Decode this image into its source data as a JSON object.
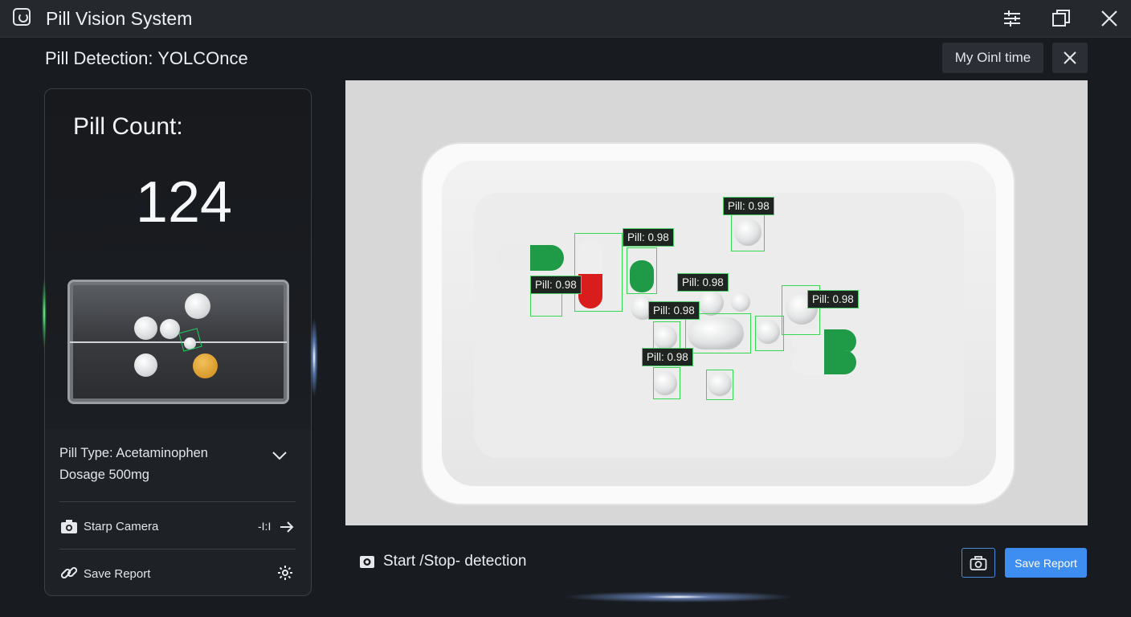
{
  "window": {
    "title": "Pill Vision System"
  },
  "header": {
    "subtitle": "Pill Detection: YOLCOnce",
    "mode_button": "My Oinl time"
  },
  "panel": {
    "count_label": "Pill Count:",
    "count_value": "124",
    "pill_type": "Pill Type: Acetaminophen",
    "dosage": "Dosage 500mg",
    "camera_label": "Starp Camera",
    "camera_value": "-I:I",
    "save_label": "Save Report"
  },
  "detections": [
    {
      "label": "Pill: 0.98"
    },
    {
      "label": "Pill: 0.98"
    },
    {
      "label": "Pill: 0.98"
    },
    {
      "label": "Pill: 0.98"
    },
    {
      "label": "Pill: 0.98"
    },
    {
      "label": "Pill: 0.98"
    },
    {
      "label": "Pill: 0.98"
    }
  ],
  "footer": {
    "start_stop_label": "Start /Stop- detection",
    "save_button": "Save Report"
  },
  "colors": {
    "accent": "#3d8ef0",
    "detection": "#35d84f",
    "capsule_green": "#1f9b48",
    "capsule_red": "#d91c1c"
  },
  "icons": [
    "app-icon",
    "sliders-icon",
    "restore-icon",
    "close-icon",
    "chevron-down-icon",
    "camera-icon",
    "arrow-right-icon",
    "link-icon",
    "gear-icon",
    "record-icon"
  ]
}
